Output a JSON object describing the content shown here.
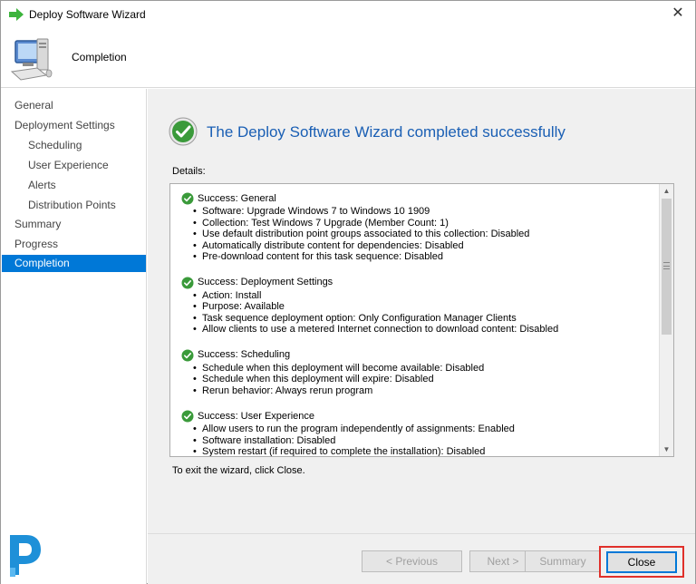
{
  "window": {
    "title": "Deploy Software Wizard"
  },
  "header": {
    "title": "Completion"
  },
  "sidebar": {
    "items": [
      {
        "label": "General",
        "sub": false,
        "active": false
      },
      {
        "label": "Deployment Settings",
        "sub": false,
        "active": false
      },
      {
        "label": "Scheduling",
        "sub": true,
        "active": false
      },
      {
        "label": "User Experience",
        "sub": true,
        "active": false
      },
      {
        "label": "Alerts",
        "sub": true,
        "active": false
      },
      {
        "label": "Distribution Points",
        "sub": true,
        "active": false
      },
      {
        "label": "Summary",
        "sub": false,
        "active": false
      },
      {
        "label": "Progress",
        "sub": false,
        "active": false
      },
      {
        "label": "Completion",
        "sub": false,
        "active": true
      }
    ]
  },
  "main": {
    "success_title": "The Deploy Software Wizard completed successfully",
    "details_label": "Details:",
    "exit_text": "To exit the wizard, click Close.",
    "sections": [
      {
        "title": "Success: General",
        "items": [
          "Software: Upgrade Windows 7 to Windows 10 1909",
          "Collection: Test Windows 7 Upgrade (Member Count: 1)",
          "Use default distribution point groups associated to this collection: Disabled",
          "Automatically distribute content for dependencies: Disabled",
          "Pre-download content for this task sequence: Disabled"
        ]
      },
      {
        "title": "Success: Deployment Settings",
        "items": [
          "Action: Install",
          "Purpose: Available",
          "Task sequence deployment option: Only Configuration Manager Clients",
          "Allow clients to use a metered Internet connection to download content: Disabled"
        ]
      },
      {
        "title": "Success: Scheduling",
        "items": [
          "Schedule when this deployment will become available: Disabled",
          "Schedule when this deployment will expire: Disabled",
          "Rerun behavior: Always rerun program"
        ]
      },
      {
        "title": "Success: User Experience",
        "items": [
          "Allow users to run the program independently of assignments: Enabled",
          "Software installation: Disabled",
          "System restart (if required to complete the installation): Disabled"
        ]
      }
    ]
  },
  "buttons": {
    "previous": "< Previous",
    "next": "Next >",
    "summary": "Summary",
    "close": "Close"
  },
  "colors": {
    "accent": "#0078d7",
    "title_blue": "#1a5fb4",
    "success_green": "#3a9a3a",
    "highlight_red": "#e0302a"
  },
  "icons": {
    "title": "green-arrow-icon",
    "header": "computer-icon",
    "success": "green-check-icon",
    "logo": "brand-logo-icon"
  }
}
